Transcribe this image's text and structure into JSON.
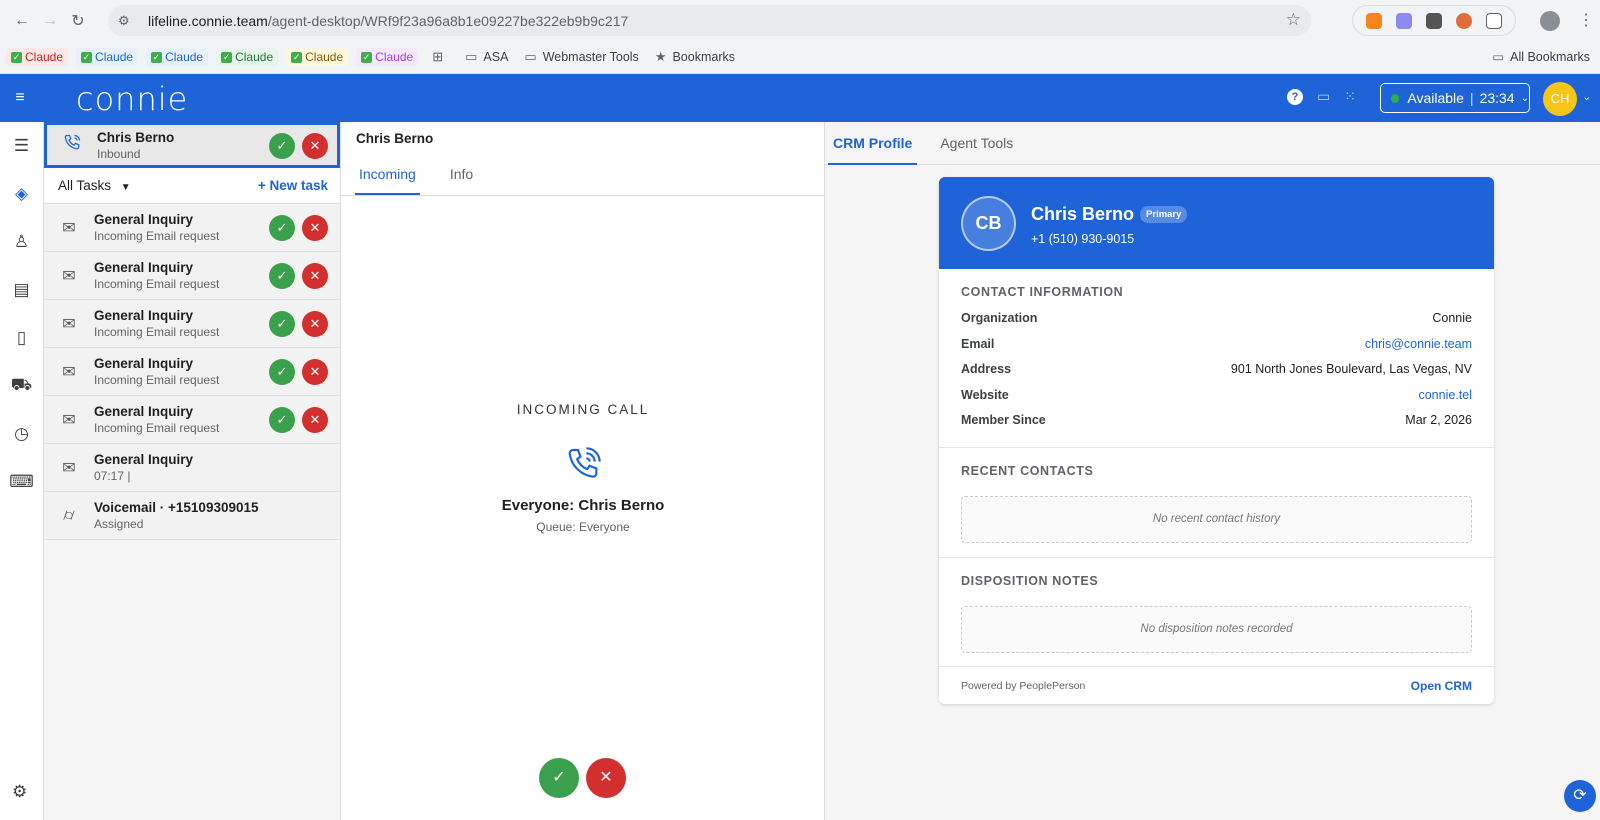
{
  "browser": {
    "url_host": "lifeline.connie.team",
    "url_path": "/agent-desktop/WRf9f23a96a8b1e09227be322eb9b9c217",
    "bookmarks": [
      {
        "label": "Claude",
        "color": "#c5221f",
        "bg": "#fce8e6"
      },
      {
        "label": "Claude",
        "color": "#1967d2",
        "bg": "#e8f0fe"
      },
      {
        "label": "Claude",
        "color": "#1967d2",
        "bg": "#e8f0fe"
      },
      {
        "label": "Claude",
        "color": "#188038",
        "bg": "#e6f4ea"
      },
      {
        "label": "Claude",
        "color": "#8a5a00",
        "bg": "#fef7e0"
      },
      {
        "label": "Claude",
        "color": "#a142f4",
        "bg": "#f3e8fd"
      }
    ],
    "folder_asa": "ASA",
    "folder_webmaster": "Webmaster Tools",
    "bookmarks_label": "Bookmarks",
    "all_bookmarks": "All Bookmarks"
  },
  "app": {
    "logo": "connie",
    "status": "Available",
    "timer": "23:34",
    "avatar_initials": "CH",
    "accent": "#1f63d8"
  },
  "active_task": {
    "name": "Chris Berno",
    "sub": "Inbound"
  },
  "task_filter": {
    "label": "All Tasks",
    "new_task": "+ New task"
  },
  "tasks": [
    {
      "name": "General Inquiry",
      "sub": "Incoming Email request"
    },
    {
      "name": "General Inquiry",
      "sub": "Incoming Email request"
    },
    {
      "name": "General Inquiry",
      "sub": "Incoming Email request"
    },
    {
      "name": "General Inquiry",
      "sub": "Incoming Email request"
    },
    {
      "name": "General Inquiry",
      "sub": "Incoming Email request"
    },
    {
      "name": "General Inquiry",
      "sub": "07:17 |"
    },
    {
      "name": "Voicemail · +15109309015",
      "sub": "Assigned"
    }
  ],
  "middle": {
    "title": "Chris Berno",
    "tab_incoming": "Incoming",
    "tab_info": "Info",
    "incoming_label": "INCOMING CALL",
    "caller": "Everyone: Chris Berno",
    "queue": "Queue: Everyone"
  },
  "right": {
    "tab_crm": "CRM Profile",
    "tab_tools": "Agent Tools",
    "initials": "CB",
    "name": "Chris Berno",
    "badge": "Primary",
    "phone": "+1 (510) 930-9015",
    "contact_heading": "CONTACT INFORMATION",
    "fields": [
      {
        "k": "Organization",
        "v": "Connie"
      },
      {
        "k": "Email",
        "v": "chris@connie.team"
      },
      {
        "k": "Address",
        "v": "901 North Jones Boulevard, Las Vegas, NV"
      },
      {
        "k": "Website",
        "v": "connie.tel"
      },
      {
        "k": "Member Since",
        "v": "Mar 2, 2026"
      }
    ],
    "recent_heading": "RECENT CONTACTS",
    "recent_empty": "No recent contact history",
    "disposition_heading": "DISPOSITION NOTES",
    "disposition_empty": "No disposition notes recorded",
    "powered_by": "Powered by PeoplePerson",
    "open_crm": "Open CRM"
  }
}
